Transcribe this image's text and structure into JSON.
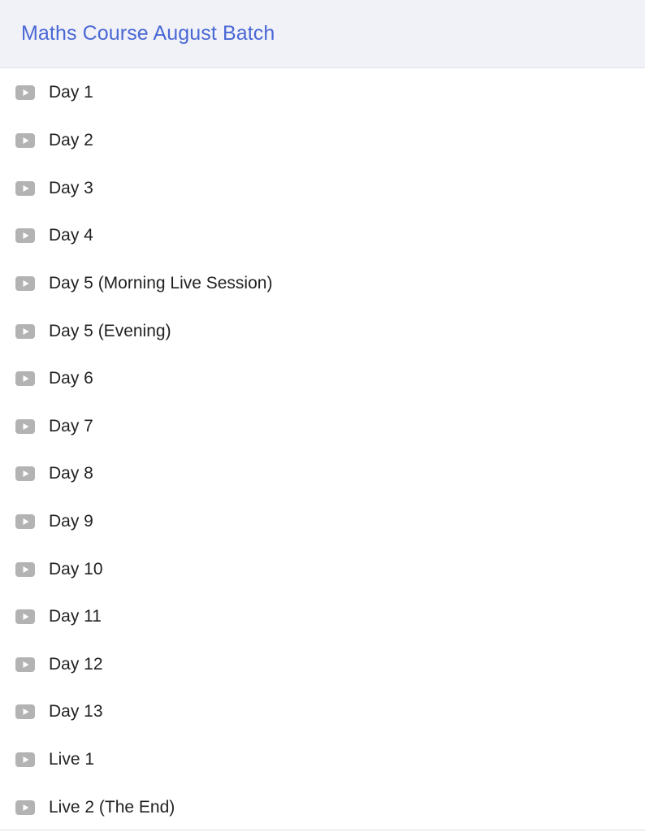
{
  "header": {
    "title": "Maths Course August Batch"
  },
  "colors": {
    "accent": "#4a68d6",
    "icon": "#b3b3b3",
    "header_bg": "#f1f2f7"
  },
  "items": [
    {
      "label": "Day 1",
      "icon": "play-icon"
    },
    {
      "label": "Day 2",
      "icon": "play-icon"
    },
    {
      "label": "Day 3",
      "icon": "play-icon"
    },
    {
      "label": "Day 4",
      "icon": "play-icon"
    },
    {
      "label": "Day 5 (Morning Live Session)",
      "icon": "play-icon"
    },
    {
      "label": "Day 5 (Evening)",
      "icon": "play-icon"
    },
    {
      "label": "Day 6",
      "icon": "play-icon"
    },
    {
      "label": "Day 7",
      "icon": "play-icon"
    },
    {
      "label": "Day 8",
      "icon": "play-icon"
    },
    {
      "label": "Day 9",
      "icon": "play-icon"
    },
    {
      "label": "Day 10",
      "icon": "play-icon"
    },
    {
      "label": "Day 11",
      "icon": "play-icon"
    },
    {
      "label": "Day 12",
      "icon": "play-icon"
    },
    {
      "label": "Day 13",
      "icon": "play-icon"
    },
    {
      "label": "Live 1",
      "icon": "play-icon"
    },
    {
      "label": "Live 2 (The End)",
      "icon": "play-icon"
    }
  ]
}
